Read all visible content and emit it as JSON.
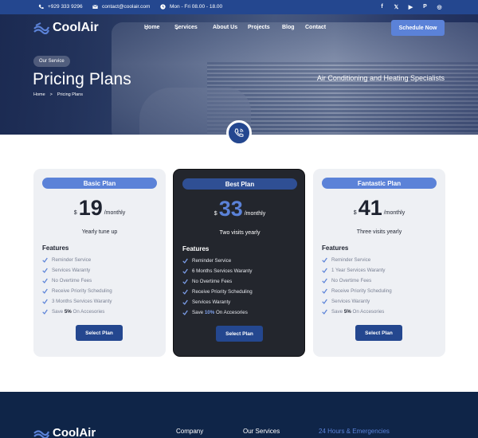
{
  "topbar": {
    "phone": "+929 333 9296",
    "email": "contact@coolair.com",
    "hours": "Mon - Fri 08.00 - 18.00",
    "socials": [
      "facebook-icon",
      "x-icon",
      "youtube-icon",
      "pinterest-icon",
      "instagram-icon"
    ]
  },
  "brand": {
    "name": "CoolAir"
  },
  "nav": {
    "items": [
      "Home",
      "Services",
      "About Us",
      "Projects",
      "Blog",
      "Contact"
    ],
    "dropdown_mark": "⌄"
  },
  "cta": {
    "label": "Schedule Now"
  },
  "hero": {
    "pill": "Our Service",
    "title": "Pricing Plans",
    "breadcrumb": {
      "home": "Home",
      "separator": ">",
      "current": "Pricing Plans"
    },
    "tagline": "Air Conditioning and Heating Specialists"
  },
  "plans": [
    {
      "label": "Basic Plan",
      "currency": "$",
      "price": "19",
      "period": "/monthly",
      "note": "Yearly tune up",
      "features_title": "Features",
      "features": [
        {
          "text": "Reminder Service"
        },
        {
          "text": "Services Waranty"
        },
        {
          "text": "No Overtime Fees"
        },
        {
          "text": "Receive Priority Scheduling"
        },
        {
          "text": "3 Months Services Waranty"
        },
        {
          "pre": "Save ",
          "bold": "5%",
          "post": " On Accesories"
        }
      ],
      "button": "Select Plan"
    },
    {
      "label": "Best Plan",
      "currency": "$",
      "price": "33",
      "period": "/monthly",
      "note": "Two visits yearly",
      "features_title": "Features",
      "features": [
        {
          "text": "Reminder Service"
        },
        {
          "text": "6 Months Services Waranty"
        },
        {
          "text": "No Overtime Fees"
        },
        {
          "text": "Receive Priority Scheduling"
        },
        {
          "text": "Services Waranty"
        },
        {
          "pre": "Save ",
          "bold": "10%",
          "post": " On Accesories"
        }
      ],
      "button": "Select Plan"
    },
    {
      "label": "Fantastic Plan",
      "currency": "$",
      "price": "41",
      "period": "/monthly",
      "note": "Three visits yearly",
      "features_title": "Features",
      "features": [
        {
          "text": "Reminder Service"
        },
        {
          "text": "1 Year Services Waranty"
        },
        {
          "text": "No Overtime Fees"
        },
        {
          "text": "Receive Priority Scheduling"
        },
        {
          "text": "Services Waranty"
        },
        {
          "pre": "Save ",
          "bold": "5%",
          "post": " On Accesories"
        }
      ],
      "button": "Select Plan"
    }
  ],
  "footer": {
    "brand": "CoolAir",
    "columns": [
      "Company",
      "Our Services",
      "24 Hours & Emergencies"
    ]
  },
  "colors": {
    "primary": "#24478f",
    "accent": "#5b82d8",
    "dark_card": "#23262d",
    "footer": "#0f2548"
  }
}
